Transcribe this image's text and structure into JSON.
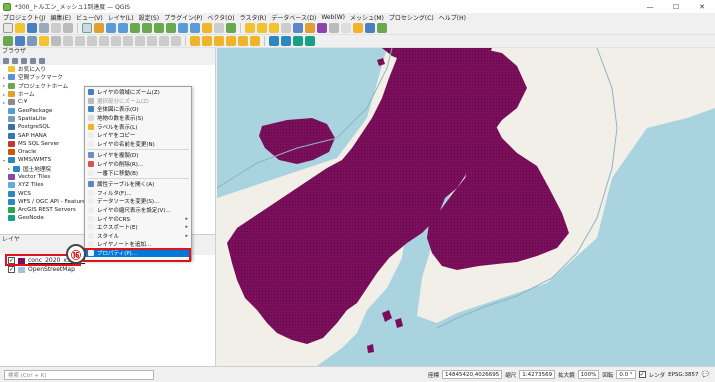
{
  "window": {
    "title": "*300_トルエン_メッシュ1到達度 — QGIS",
    "minimize": "—",
    "maximize": "☐",
    "close": "✕"
  },
  "menu": [
    "プロジェクト(J)",
    "編集(E)",
    "ビュー(V)",
    "レイヤ(L)",
    "設定(S)",
    "プラグイン(P)",
    "ベクタ(O)",
    "ラスタ(R)",
    "データベース(D)",
    "Web(W)",
    "メッシュ(M)",
    "プロセシング(C)",
    "ヘルプ(H)"
  ],
  "browser": {
    "title": "ブラウザ",
    "items": [
      {
        "label": "お気に入り",
        "color": "#f2c230",
        "expand": ""
      },
      {
        "label": "空間ブックマーク",
        "color": "#5c8fd6",
        "expand": "▸"
      },
      {
        "label": "プロジェクトホーム",
        "color": "#6aa84f",
        "expand": "▸"
      },
      {
        "label": "ホーム",
        "color": "#e0a030",
        "expand": "▸"
      },
      {
        "label": "C:¥",
        "color": "#8a8a8a",
        "expand": "▸"
      },
      {
        "label": "GeoPackage",
        "color": "#5b9bd5",
        "expand": ""
      },
      {
        "label": "SpatiaLite",
        "color": "#7a9bb8",
        "expand": ""
      },
      {
        "label": "PostgreSQL",
        "color": "#3b6ea5",
        "expand": ""
      },
      {
        "label": "SAP HANA",
        "color": "#2a7ab8",
        "expand": ""
      },
      {
        "label": "MS SQL Server",
        "color": "#c0392b",
        "expand": ""
      },
      {
        "label": "Oracle",
        "color": "#d35400",
        "expand": ""
      },
      {
        "label": "WMS/WMTS",
        "color": "#2e86c1",
        "expand": "▾"
      },
      {
        "label": "国土地理院",
        "color": "#2e86c1",
        "expand": "▸",
        "child": true
      },
      {
        "label": "Vector Tiles",
        "color": "#8e44ad",
        "expand": ""
      },
      {
        "label": "XYZ Tiles",
        "color": "#5dade2",
        "expand": ""
      },
      {
        "label": "WCS",
        "color": "#2e86c1",
        "expand": ""
      },
      {
        "label": "WFS / OGC API - Features",
        "color": "#2e86c1",
        "expand": ""
      },
      {
        "label": "ArcGIS REST Servers",
        "color": "#28a745",
        "expand": ""
      },
      {
        "label": "GeoNode",
        "color": "#16a085",
        "expand": ""
      }
    ]
  },
  "layers": {
    "title": "レイヤ",
    "items": [
      {
        "label": "conc_2020_x5_300",
        "checked": "✓"
      },
      {
        "label": "OpenStreetMap",
        "checked": "✓"
      }
    ]
  },
  "context_menu": {
    "items": [
      {
        "label": "レイヤの領域にズーム(Z)",
        "color": "#4a7fc1",
        "sub": ""
      },
      {
        "label": "選択部分にズーム(Z)",
        "color": "#bbbbbb",
        "sub": "",
        "disabled": true
      },
      {
        "label": "全体図に表示(O)",
        "color": "#4a7fc1",
        "sub": ""
      },
      {
        "label": "地物の数を表示(S)",
        "color": "#dddddd",
        "sub": ""
      },
      {
        "label": "ラベルを表示(L)",
        "color": "#f0b429",
        "sub": ""
      },
      {
        "label": "レイヤをコピー",
        "color": "#eeeeee",
        "sub": ""
      },
      {
        "label": "レイヤの名前を変更(N)",
        "color": "#eeeeee",
        "sub": ""
      },
      {
        "sep": true
      },
      {
        "label": "レイヤを複製(D)",
        "color": "#6f8fbf",
        "sub": ""
      },
      {
        "label": "レイヤの削除(R)...",
        "color": "#d9534f",
        "sub": ""
      },
      {
        "label": "一番下に移動(B)",
        "color": "#eeeeee",
        "sub": ""
      },
      {
        "sep": true
      },
      {
        "label": "属性テーブルを開く(A)",
        "color": "#5b87c4",
        "sub": ""
      },
      {
        "label": "フィルタ(F)...",
        "color": "#eeeeee",
        "sub": ""
      },
      {
        "label": "データソースを変更(S)...",
        "color": "#eeeeee",
        "sub": ""
      },
      {
        "label": "レイヤの縮尺表示を設定(V)...",
        "color": "#eeeeee",
        "sub": ""
      },
      {
        "label": "レイヤのCRS",
        "color": "#eeeeee",
        "sub": "▸"
      },
      {
        "label": "エクスポート(E)",
        "color": "#eeeeee",
        "sub": "▸"
      },
      {
        "label": "スタイル",
        "color": "#eeeeee",
        "sub": "▸"
      },
      {
        "label": "レイヤノートを追加...",
        "color": "#eeeeee",
        "sub": ""
      },
      {
        "label": "プロパティ(P)...",
        "color": "#eeeeee",
        "sub": "",
        "highlight": true
      }
    ]
  },
  "annotation": {
    "number": "⑯"
  },
  "status": {
    "search_placeholder": "検索 (Ctrl + K)",
    "coord_label": "座標",
    "coord": "14845420,4026695",
    "scale_label": "縮尺",
    "scale": "1:4273569",
    "magnifier_label": "拡大鏡",
    "magnifier": "100%",
    "rotation_label": "回転",
    "rotation": "0.0 °",
    "render_label": "レンダ",
    "crs": "EPSG:3857"
  },
  "colors": {
    "raster": "#7b0f5c",
    "sea": "#a9d3df",
    "land": "#f2efe9",
    "highlight": "#0078d7",
    "annotation": "#e0121a"
  }
}
